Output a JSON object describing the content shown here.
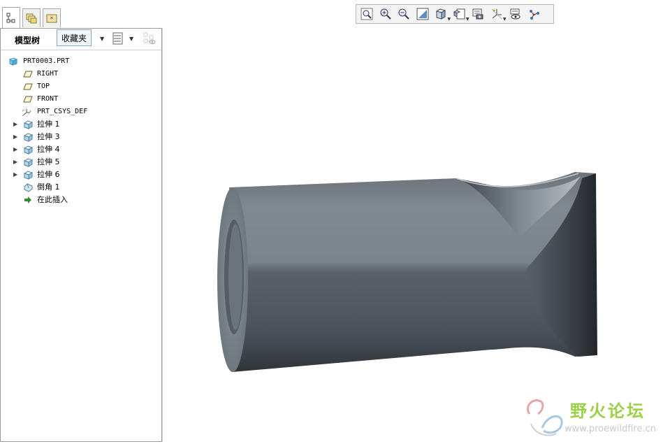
{
  "nav_tabs": [
    {
      "name": "model-tree-tab",
      "icon": "tree-hierarchy-icon"
    },
    {
      "name": "folder-browser-tab",
      "icon": "folder-icon"
    },
    {
      "name": "favorites-tab",
      "icon": "star-folder-icon"
    }
  ],
  "panel": {
    "title": "模型树",
    "tooltip": "收藏夹"
  },
  "tree": {
    "root": "PRT0003.PRT",
    "items": [
      {
        "label": "RIGHT",
        "icon": "datum-plane-icon",
        "expandable": false
      },
      {
        "label": "TOP",
        "icon": "datum-plane-icon",
        "expandable": false
      },
      {
        "label": "FRONT",
        "icon": "datum-plane-icon",
        "expandable": false
      },
      {
        "label": "PRT_CSYS_DEF",
        "icon": "coordinate-system-icon",
        "expandable": false
      },
      {
        "label": "拉伸 1",
        "icon": "extrude-icon",
        "expandable": true
      },
      {
        "label": "拉伸 3",
        "icon": "extrude-icon",
        "expandable": true
      },
      {
        "label": "拉伸 4",
        "icon": "extrude-icon",
        "expandable": true
      },
      {
        "label": "拉伸 5",
        "icon": "extrude-icon",
        "expandable": true
      },
      {
        "label": "拉伸 6",
        "icon": "extrude-icon",
        "expandable": true
      },
      {
        "label": "倒角 1",
        "icon": "chamfer-icon",
        "expandable": false
      },
      {
        "label": "在此插入",
        "icon": "insert-here-arrow-icon",
        "expandable": false
      }
    ]
  },
  "toolbar": [
    {
      "name": "refit-button",
      "icon": "zoom-fit-icon"
    },
    {
      "name": "zoom-in-button",
      "icon": "zoom-in-icon"
    },
    {
      "name": "zoom-out-button",
      "icon": "zoom-out-icon"
    },
    {
      "name": "repaint-button",
      "icon": "repaint-icon"
    },
    {
      "name": "display-style-button",
      "icon": "shaded-cube-icon"
    },
    {
      "name": "saved-views-button",
      "icon": "saved-views-icon"
    },
    {
      "name": "view-manager-button",
      "icon": "view-manager-icon"
    },
    {
      "name": "datum-display-button",
      "icon": "datum-display-icon"
    },
    {
      "name": "annotation-display-button",
      "icon": "annotation-display-icon"
    },
    {
      "name": "spin-center-button",
      "icon": "spin-center-icon"
    }
  ],
  "watermark": {
    "title": "野火论坛",
    "url": "www.proewildfire.cn"
  },
  "colors": {
    "model_dark": "#3e444b",
    "model_mid": "#7e878f",
    "watermark_green": "#9ccf4a"
  }
}
